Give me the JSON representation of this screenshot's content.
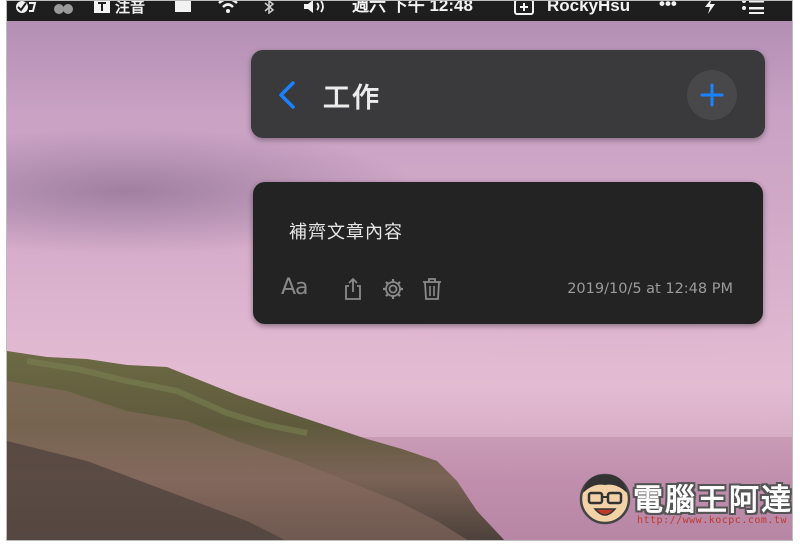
{
  "menubar": {
    "input_method": "注音",
    "datetime": "週六 下午 12:48",
    "username": "RockyHsu",
    "more": "•••"
  },
  "header": {
    "back_icon": "chevron-left-icon",
    "title": "工作",
    "add_icon": "plus-icon",
    "accent_color": "#1a82ff"
  },
  "note": {
    "text": "補齊文章內容",
    "font_button_label": "Aa",
    "share_icon": "share-icon",
    "settings_icon": "gear-icon",
    "delete_icon": "trash-icon",
    "timestamp": "2019/10/5 at 12:48 PM"
  },
  "watermark": {
    "brand": "電腦王阿達",
    "url": "http://www.kocpc.com.tw"
  }
}
